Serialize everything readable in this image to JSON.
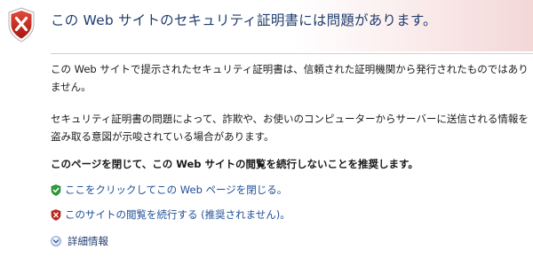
{
  "header": {
    "title": "この Web サイトのセキュリティ証明書には問題があります。",
    "accent_color": "#1f3d6d",
    "icon": "security-shield-error-icon"
  },
  "body": {
    "paragraph1": "この Web サイトで提示されたセキュリティ証明書は、信頼された証明機関から発行されたものではありません。",
    "paragraph2": "セキュリティ証明書の問題によって、詐欺や、お使いのコンピューターからサーバーに送信される情報を盗み取る意図が示唆されている場合があります。",
    "recommendation": "このページを閉じて、この Web サイトの閲覧を続行しないことを推奨します。"
  },
  "actions": [
    {
      "label": "ここをクリックしてこの Web ページを閉じる。",
      "icon": "green-shield-check-icon",
      "color": "#1f4e96"
    },
    {
      "label": "このサイトの閲覧を続行する (推奨されません)。",
      "icon": "red-shield-x-icon",
      "color": "#1f4e96"
    }
  ],
  "details": {
    "label": "詳細情報",
    "icon": "chevron-down-circle-icon"
  }
}
